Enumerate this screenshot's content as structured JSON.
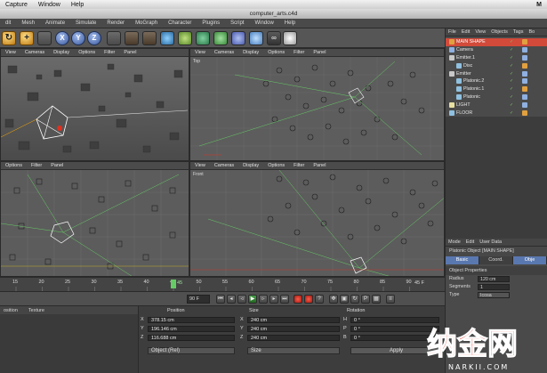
{
  "mac_menu": [
    "Capture",
    "Window",
    "Help"
  ],
  "mac_right": "M",
  "window_title": "computer_arts.c4d",
  "app_menu": [
    "dit",
    "Mesh",
    "Animate",
    "Simulate",
    "Render",
    "MoGraph",
    "Character",
    "Plugins",
    "Script",
    "Window",
    "Help"
  ],
  "toolbar": {
    "x_axis": "X",
    "y_axis": "Y",
    "z_axis": "Z",
    "move_icon": "+"
  },
  "viewports": {
    "perspective": {
      "menu": [
        "View",
        "Cameras",
        "Display",
        "Options",
        "Filter",
        "Panel"
      ]
    },
    "top": {
      "menu": [
        "View",
        "Cameras",
        "Display",
        "Options",
        "Filter",
        "Panel"
      ],
      "label": "Top"
    },
    "right": {
      "menu": [
        "Options",
        "Filter",
        "Panel"
      ]
    },
    "front": {
      "menu": [
        "View",
        "Cameras",
        "Display",
        "Options",
        "Filter",
        "Panel"
      ],
      "label": "Front"
    }
  },
  "object_manager": {
    "menu": [
      "File",
      "Edit",
      "View",
      "Objects",
      "Tags",
      "Bo"
    ],
    "objects": [
      {
        "name": "MAIN SHAPE",
        "selected": true,
        "color": "#e0a040"
      },
      {
        "name": "Camera",
        "selected": false,
        "color": "#8fb0e0"
      },
      {
        "name": "Emitter.1",
        "selected": false,
        "color": "#c8c8c8"
      },
      {
        "name": "Disc",
        "selected": false,
        "color": "#8fc0e0"
      },
      {
        "name": "Emitter",
        "selected": false,
        "color": "#c8c8c8"
      },
      {
        "name": "Platonic.2",
        "selected": false,
        "color": "#8fc0e0"
      },
      {
        "name": "Platonic.1",
        "selected": false,
        "color": "#8fc0e0"
      },
      {
        "name": "Platonic",
        "selected": false,
        "color": "#8fc0e0"
      },
      {
        "name": "LIGHT",
        "selected": false,
        "color": "#e8e0a0"
      },
      {
        "name": "FLOOR",
        "selected": false,
        "color": "#8fc0e0"
      }
    ]
  },
  "attribute_manager": {
    "menu": [
      "Mode",
      "Edit",
      "User Data"
    ],
    "title": "Platonic Object [MAIN SHAPE]",
    "tabs": [
      "Basic",
      "Coord.",
      "Obje"
    ],
    "section": "Object Properties",
    "fields": [
      {
        "label": "Radius",
        "value": "120 cm"
      },
      {
        "label": "Segments",
        "value": "1"
      },
      {
        "label": "Type",
        "value": "Icosa"
      }
    ]
  },
  "timeline": {
    "ticks": [
      "15",
      "20",
      "25",
      "30",
      "35",
      "40",
      "45",
      "50",
      "55",
      "60",
      "65",
      "70",
      "75",
      "80",
      "85",
      "90"
    ],
    "current_frame": "45",
    "end_frame": "45 F",
    "frame_field": "90 F"
  },
  "coordinates": {
    "tabs": [
      "osition",
      "Texture"
    ],
    "headers": {
      "position": "Position",
      "size": "Size",
      "rotation": "Rotation"
    },
    "rows": [
      {
        "axis": "X",
        "pos": "378.15 cm",
        "size_axis": "X",
        "size": "240 cm",
        "rot_axis": "H",
        "rot": "0 °"
      },
      {
        "axis": "Y",
        "pos": "196.146 cm",
        "size_axis": "Y",
        "size": "240 cm",
        "rot_axis": "P",
        "rot": "0 °"
      },
      {
        "axis": "Z",
        "pos": "116.688 cm",
        "size_axis": "Z",
        "size": "240 cm",
        "rot_axis": "B",
        "rot": "0 °"
      }
    ],
    "mode_dropdown": "Object (Rel)",
    "size_dropdown": "Size",
    "apply_label": "Apply"
  },
  "watermark": {
    "text": "纳金网",
    "sub": "NARKII.COM"
  },
  "colors": {
    "accent_red": "#d24a3a",
    "selected_tab": "#5a78b0",
    "grid_green": "#66cc66"
  }
}
